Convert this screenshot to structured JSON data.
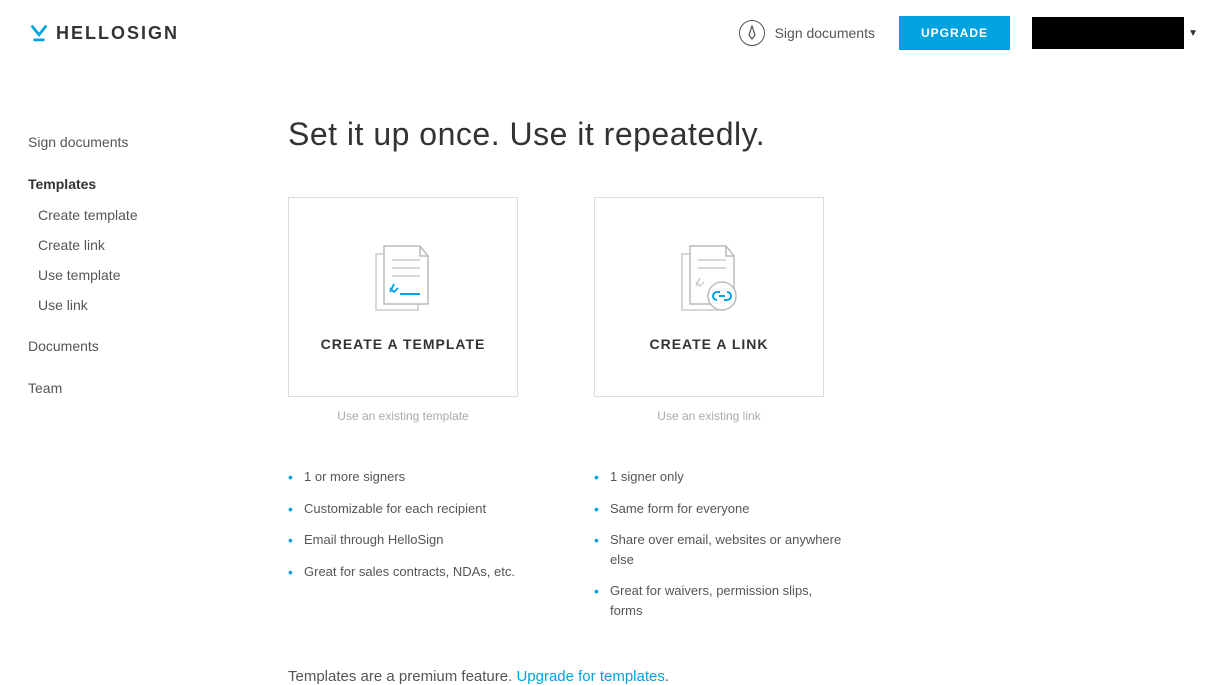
{
  "header": {
    "brand": "HELLOSIGN",
    "sign_documents": "Sign documents",
    "upgrade": "UPGRADE"
  },
  "sidebar": {
    "items": [
      {
        "label": "Sign documents"
      },
      {
        "label": "Templates",
        "active": true
      },
      {
        "label": "Documents"
      },
      {
        "label": "Team"
      }
    ],
    "templates_sub": [
      {
        "label": "Create template"
      },
      {
        "label": "Create link"
      },
      {
        "label": "Use template"
      },
      {
        "label": "Use link"
      }
    ]
  },
  "main": {
    "title": "Set it up once. Use it repeatedly.",
    "cards": [
      {
        "title": "CREATE A TEMPLATE",
        "sub": "Use an existing template"
      },
      {
        "title": "CREATE A LINK",
        "sub": "Use an existing link"
      }
    ],
    "features_template": [
      "1 or more signers",
      "Customizable for each recipient",
      "Email through HelloSign",
      "Great for sales contracts, NDAs, etc."
    ],
    "features_link": [
      "1 signer only",
      "Same form for everyone",
      "Share over email, websites or anywhere else",
      "Great for waivers, permission slips, forms"
    ],
    "premium_text": "Templates are a premium feature. ",
    "premium_link": "Upgrade for templates",
    "premium_dot": "."
  }
}
